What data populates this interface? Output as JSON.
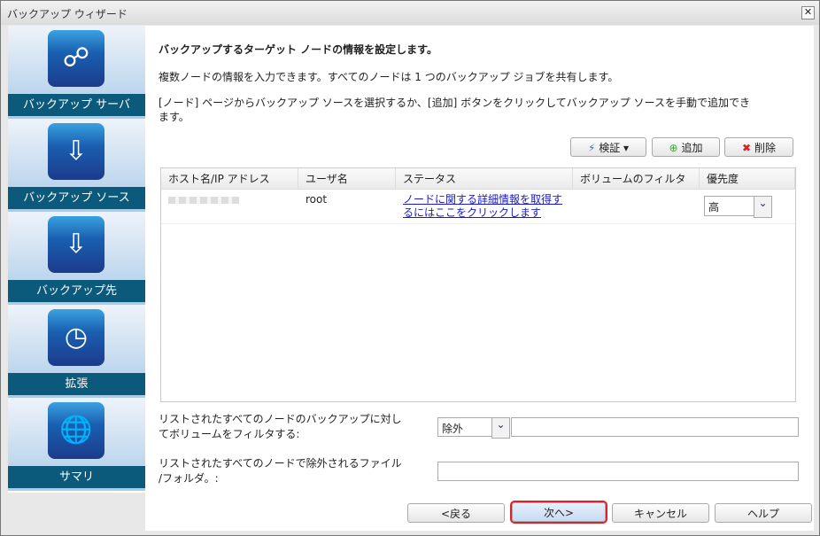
{
  "window": {
    "title": "バックアップ ウィザード",
    "close": "✕"
  },
  "sidebar": {
    "items": [
      {
        "label": "バックアップ サーバ",
        "icon": "network-icon",
        "glyph": "☍"
      },
      {
        "label": "バックアップ ソース",
        "icon": "drive-download-icon",
        "glyph": "⇩"
      },
      {
        "label": "バックアップ先",
        "icon": "drive-upload-icon",
        "glyph": "⇩"
      },
      {
        "label": "拡張",
        "icon": "clock-icon",
        "glyph": "◷"
      },
      {
        "label": "サマリ",
        "icon": "globe-icon",
        "glyph": "🌐"
      }
    ]
  },
  "main": {
    "heading": "バックアップするターゲット ノードの情報を設定します。",
    "line1": "複数ノードの情報を入力できます。すべてのノードは 1 つのバックアップ ジョブを共有します。",
    "line2": "[ノード] ページからバックアップ ソースを選択するか、[追加] ボタンをクリックしてバックアップ ソースを手動で追加でき",
    "line3": "ます。",
    "toolbar": {
      "verify": "検証",
      "add": "追加",
      "delete": "削除"
    },
    "columns": [
      "ホスト名/IP アドレス",
      "ユーザ名",
      "ステータス",
      "ボリュームのフィルタ",
      "優先度"
    ],
    "rows": [
      {
        "host": "",
        "user": "root",
        "status1": "ノードに関する詳細情報を取得す",
        "status2": "るにはここをクリックします",
        "priority": "高"
      }
    ],
    "filter_label1": "リストされたすべてのノードのバックアップに対し",
    "filter_label2": "てボリュームをフィルタする:",
    "filter_mode": "除外",
    "filter_value": "",
    "exclude_label1": "リストされたすべてのノードで除外されるファイル",
    "exclude_label2": "/フォルダ。:",
    "exclude_value": ""
  },
  "footer": {
    "back": "<戻る",
    "next": "次へ>",
    "cancel": "キャンセル",
    "help": "ヘルプ"
  }
}
